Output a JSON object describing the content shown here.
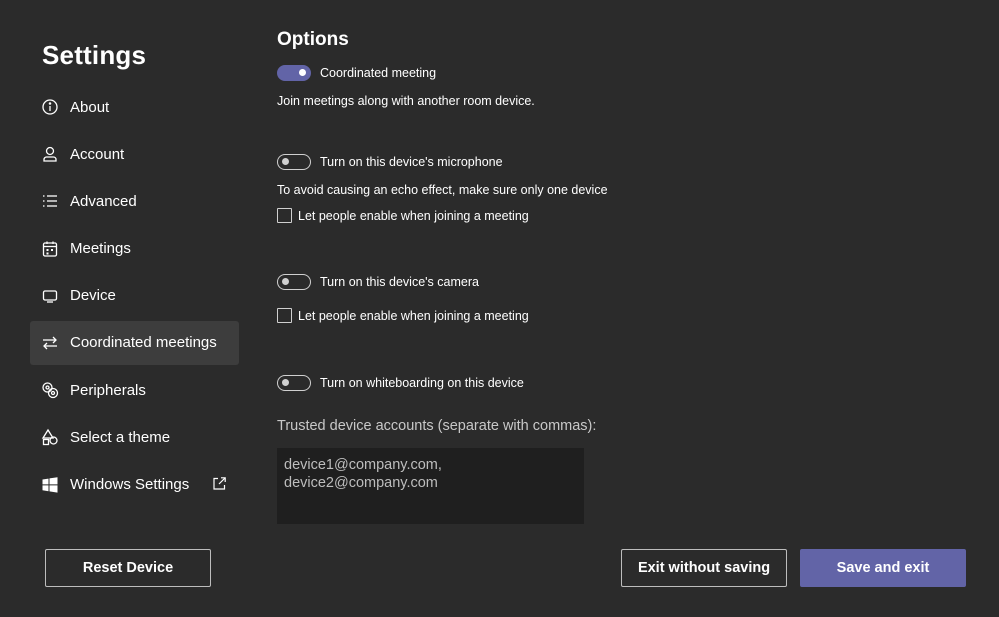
{
  "sidebar": {
    "title": "Settings",
    "items": [
      {
        "label": "About",
        "icon": "info-icon"
      },
      {
        "label": "Account",
        "icon": "person-icon"
      },
      {
        "label": "Advanced",
        "icon": "list-icon"
      },
      {
        "label": "Meetings",
        "icon": "calendar-icon"
      },
      {
        "label": "Device",
        "icon": "monitor-icon"
      },
      {
        "label": "Coordinated meetings",
        "icon": "swap-arrows-icon",
        "active": true
      },
      {
        "label": "Peripherals",
        "icon": "peripherals-icon"
      },
      {
        "label": "Select a theme",
        "icon": "shapes-icon"
      },
      {
        "label": "Windows Settings",
        "icon": "windows-icon",
        "external": "external-link-icon"
      }
    ]
  },
  "options": {
    "title": "Options",
    "coordinated": {
      "label": "Coordinated meeting",
      "on": true,
      "description": "Join meetings along with another room device."
    },
    "microphone": {
      "label": "Turn on this device's microphone",
      "on": false,
      "description": "To avoid causing an echo effect, make sure only one device",
      "checkbox_label": "Let people enable when joining a meeting"
    },
    "camera": {
      "label": "Turn on this device's camera",
      "on": false,
      "checkbox_label": "Let people enable when joining a meeting"
    },
    "whiteboard": {
      "label": "Turn on whiteboarding on this device",
      "on": false
    },
    "trusted": {
      "label": "Trusted device accounts (separate with commas):",
      "value": "device1@company.com,\ndevice2@company.com"
    }
  },
  "footer": {
    "reset_label": "Reset Device",
    "exit_label": "Exit without saving",
    "save_label": "Save and exit"
  },
  "colors": {
    "accent": "#6264a7",
    "background": "#2b2b2b",
    "active_nav": "#3d3d3d",
    "input_bg": "#1f1f1f"
  }
}
